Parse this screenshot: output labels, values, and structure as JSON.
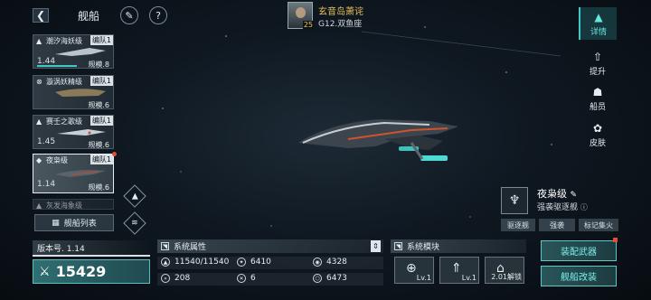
{
  "header": {
    "back_icon": "chevron-left-icon",
    "title": "舰船",
    "rename_icon": "edit-pen-icon",
    "help_icon": "question-icon"
  },
  "player": {
    "name": "玄音岛萧诧",
    "level": "25",
    "server": "G12.双鱼座"
  },
  "ship_list": [
    {
      "name": "潮汐海妖级",
      "fleet": "编队1",
      "number": "1.44",
      "scale": "规模.8"
    },
    {
      "name": "漩涡妖精级",
      "fleet": "编队1",
      "number": "",
      "scale": "规模.6"
    },
    {
      "name": "赛壬之歌级",
      "fleet": "编队1",
      "number": "1.45",
      "scale": "规模.6"
    },
    {
      "name": "夜枭级",
      "fleet": "编队1",
      "number": "1.14",
      "scale": "规模.6"
    },
    {
      "name": "灰发海象级",
      "fleet": "",
      "number": "",
      "scale": ""
    }
  ],
  "fleet_list_label": "舰船列表",
  "right_nav": [
    {
      "label": "详情",
      "icon": "ship-detail-icon",
      "active": true
    },
    {
      "label": "提升",
      "icon": "upgrade-icon",
      "active": false
    },
    {
      "label": "船员",
      "icon": "crew-icon",
      "active": false
    },
    {
      "label": "皮肤",
      "icon": "skin-icon",
      "active": false
    }
  ],
  "ship_info": {
    "name": "夜枭级",
    "subtitle": "强袭驱逐舰",
    "tags": [
      "驱逐舰",
      "强袭",
      "标记集火"
    ]
  },
  "version_label": "版本号. 1.14",
  "power": "15429",
  "attributes_title": "系统属性",
  "attributes": [
    {
      "icon": "hull-icon",
      "value": "11540/11540"
    },
    {
      "icon": "attack-icon",
      "value": "6410"
    },
    {
      "icon": "defense-icon",
      "value": "4328"
    },
    {
      "icon": "speed-icon",
      "value": "208"
    },
    {
      "icon": "crit-icon",
      "value": "6"
    },
    {
      "icon": "shield-icon",
      "value": "6473"
    }
  ],
  "modules_title": "系统模块",
  "modules": [
    {
      "icon": "targeting-module-icon",
      "level": "Lv.1"
    },
    {
      "icon": "engine-module-icon",
      "level": "Lv.1"
    },
    {
      "icon": "locked-module-icon",
      "level": "2.01解锁"
    }
  ],
  "actions": {
    "equip_weapon": "装配武器",
    "modify_ship": "舰船改装"
  },
  "colors": {
    "accent": "#3fc8c4",
    "accent_text": "#7af0ea",
    "gold_text": "#e8c25a",
    "alert": "#e84a33"
  }
}
